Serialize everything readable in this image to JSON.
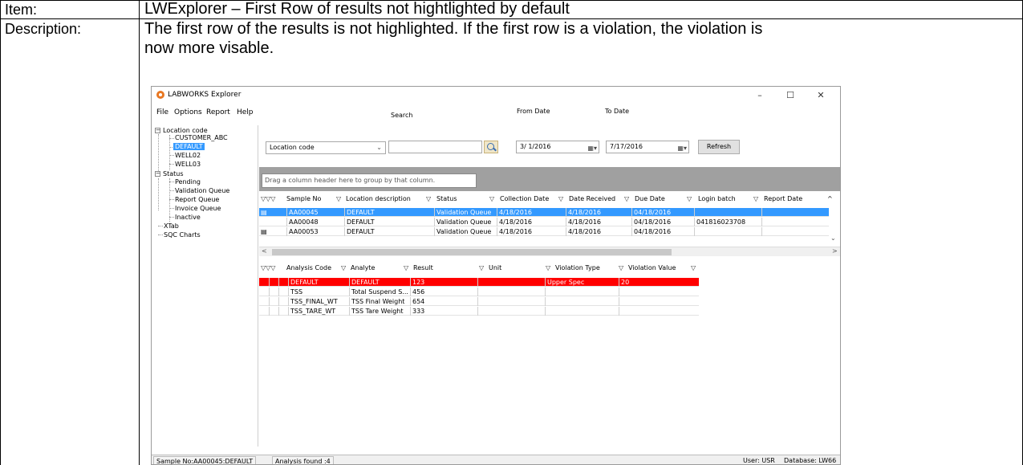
{
  "doc": {
    "item_label": "Item:",
    "item_value": "LWExplorer – First Row of results not hightlighted by default",
    "desc_label": "Description:",
    "desc_line1": "The first row of the results is not highlighted.  If the first row is a violation, the violation is",
    "desc_line2": "now more visable."
  },
  "window": {
    "title": "LABWORKS Explorer",
    "minimize": "–",
    "maximize": "☐",
    "close": "✕"
  },
  "menu": [
    "File",
    "Options",
    "Report",
    "Help"
  ],
  "tree": {
    "location_root": "Location code",
    "locations": [
      "CUSTOMER_ABC",
      "DEFAULT",
      "WELL02",
      "WELL03"
    ],
    "selected_location": "DEFAULT",
    "status_root": "Status",
    "statuses": [
      "Pending",
      "Validation Queue",
      "Report Queue",
      "Invoice Queue",
      "Inactive"
    ],
    "xtab": "XTab",
    "sqc": "SQC Charts"
  },
  "toolbar": {
    "search_label": "Search",
    "combo_value": "Location code",
    "search_value": "",
    "from_label": "From Date",
    "from_value": "3/ 1/2016",
    "to_label": "To Date",
    "to_value": "7/17/2016",
    "refresh": "Refresh"
  },
  "group_panel": "Drag a column header here to group by that column.",
  "samples": {
    "headers": [
      "Sample No",
      "Location description",
      "Status",
      "Collection Date",
      "Date Received",
      "Due Date",
      "Login batch",
      "Report Date"
    ],
    "rows": [
      [
        "AA00045",
        "DEFAULT",
        "Validation Queue",
        "4/18/2016",
        "4/18/2016",
        "04/18/2016",
        "",
        ""
      ],
      [
        "AA00048",
        "DEFAULT",
        "Validation Queue",
        "4/18/2016",
        "4/18/2016",
        "04/18/2016",
        "041816023708",
        ""
      ],
      [
        "AA00053",
        "DEFAULT",
        "Validation Queue",
        "4/18/2016",
        "4/18/2016",
        "04/18/2016",
        "",
        ""
      ]
    ]
  },
  "analyses": {
    "headers": [
      "Analysis Code",
      "Analyte",
      "Result",
      "Unit",
      "Violation Type",
      "Violation Value"
    ],
    "rows": [
      [
        "DEFAULT",
        "DEFAULT",
        "123",
        "",
        "Upper Spec",
        "20"
      ],
      [
        "TSS",
        "Total Suspend S...",
        "456",
        "",
        "",
        ""
      ],
      [
        "TSS_FINAL_WT",
        "TSS Final Weight",
        "654",
        "",
        "",
        ""
      ],
      [
        "TSS_TARE_WT",
        "TSS Tare Weight",
        "333",
        "",
        "",
        ""
      ]
    ]
  },
  "status": {
    "sample": "Sample No:AA00045:DEFAULT",
    "analysis": "Analysis found :4",
    "user": "User: USR",
    "database": "Database: LW66"
  },
  "colors": {
    "selection": "#3399ff",
    "violation": "#ff0000"
  }
}
